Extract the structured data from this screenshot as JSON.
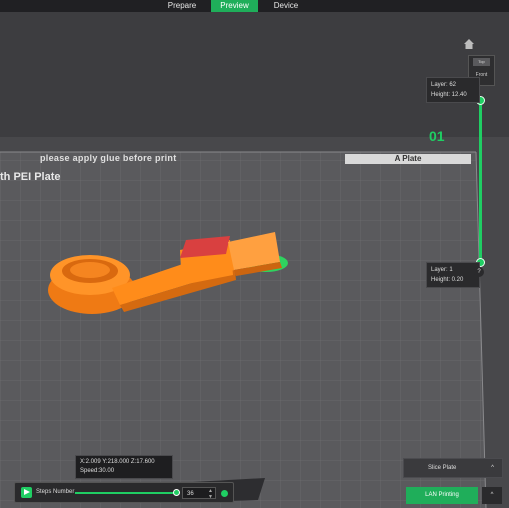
{
  "tabs": {
    "prepare": "Prepare",
    "preview": "Preview",
    "device": "Device"
  },
  "view_cube": {
    "top": "Top",
    "front": "Front"
  },
  "layer_top": {
    "layer": "Layer: 62",
    "height": "Height: 12.40"
  },
  "layer_bottom": {
    "layer": "Layer: 1",
    "height": "Height: 0.20"
  },
  "help": "?",
  "plate": {
    "glue_notice": "please apply glue before print",
    "name": "A Plate",
    "type_text": "th PEI Plate",
    "number": "01"
  },
  "coords": {
    "xyz": "X:2.009  Y:218.000  Z:17.600",
    "speed": "Speed:30.00"
  },
  "moves": {
    "label": "Steps Number",
    "value": "36",
    "progress": 0.93
  },
  "slice": {
    "label": "Slice Plate",
    "caret": "^"
  },
  "print": {
    "label": "LAN Printing",
    "caret": "^"
  },
  "colors": {
    "accent": "#1fce63",
    "model": "#ff8c1a",
    "top_surface": "#d94040"
  }
}
